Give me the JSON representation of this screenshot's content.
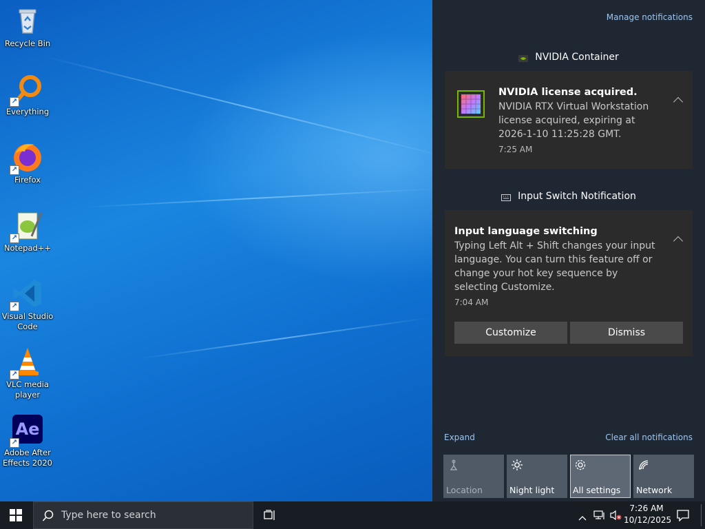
{
  "desktop": {
    "icons": [
      {
        "label": "Recycle Bin",
        "icon": "recycle-bin-icon"
      },
      {
        "label": "Everything",
        "icon": "everything-search-icon"
      },
      {
        "label": "Firefox",
        "icon": "firefox-icon"
      },
      {
        "label": "Notepad++",
        "icon": "notepadpp-icon"
      },
      {
        "label": "Visual Studio Code",
        "icon": "vscode-icon"
      },
      {
        "label": "VLC media player",
        "icon": "vlc-icon"
      },
      {
        "label": "Adobe After Effects 2020",
        "icon": "after-effects-icon",
        "badge": "Ae"
      }
    ]
  },
  "action_center": {
    "manage_link": "Manage notifications",
    "groups": [
      {
        "app": "NVIDIA Container",
        "toast": {
          "title": "NVIDIA license acquired.",
          "body": "NVIDIA RTX Virtual Workstation license acquired, expiring at 2026-1-10 11:25:28 GMT.",
          "time": "7:25 AM"
        }
      },
      {
        "app": "Input Switch Notification",
        "toast": {
          "title": "Input language switching",
          "body": "Typing Left Alt + Shift changes your input language. You can turn this feature off or change your hot key sequence by selecting Customize.",
          "time": "7:04 AM",
          "buttons": [
            "Customize",
            "Dismiss"
          ]
        }
      }
    ],
    "expand_label": "Expand",
    "clear_label": "Clear all notifications",
    "quick_actions": [
      {
        "label": "Location",
        "icon": "location-icon",
        "state": "disabled"
      },
      {
        "label": "Night light",
        "icon": "night-light-icon",
        "state": "off"
      },
      {
        "label": "All settings",
        "icon": "gear-icon",
        "state": "focused"
      },
      {
        "label": "Network",
        "icon": "network-icon",
        "state": "off"
      }
    ]
  },
  "taskbar": {
    "search_placeholder": "Type here to search",
    "time": "7:26 AM",
    "date": "10/12/2025"
  },
  "colors": {
    "action_center_bg": "#1f2733",
    "toast_bg": "#2b2b2b",
    "link": "#9dc6ef",
    "taskbar_bg": "#181d24"
  }
}
